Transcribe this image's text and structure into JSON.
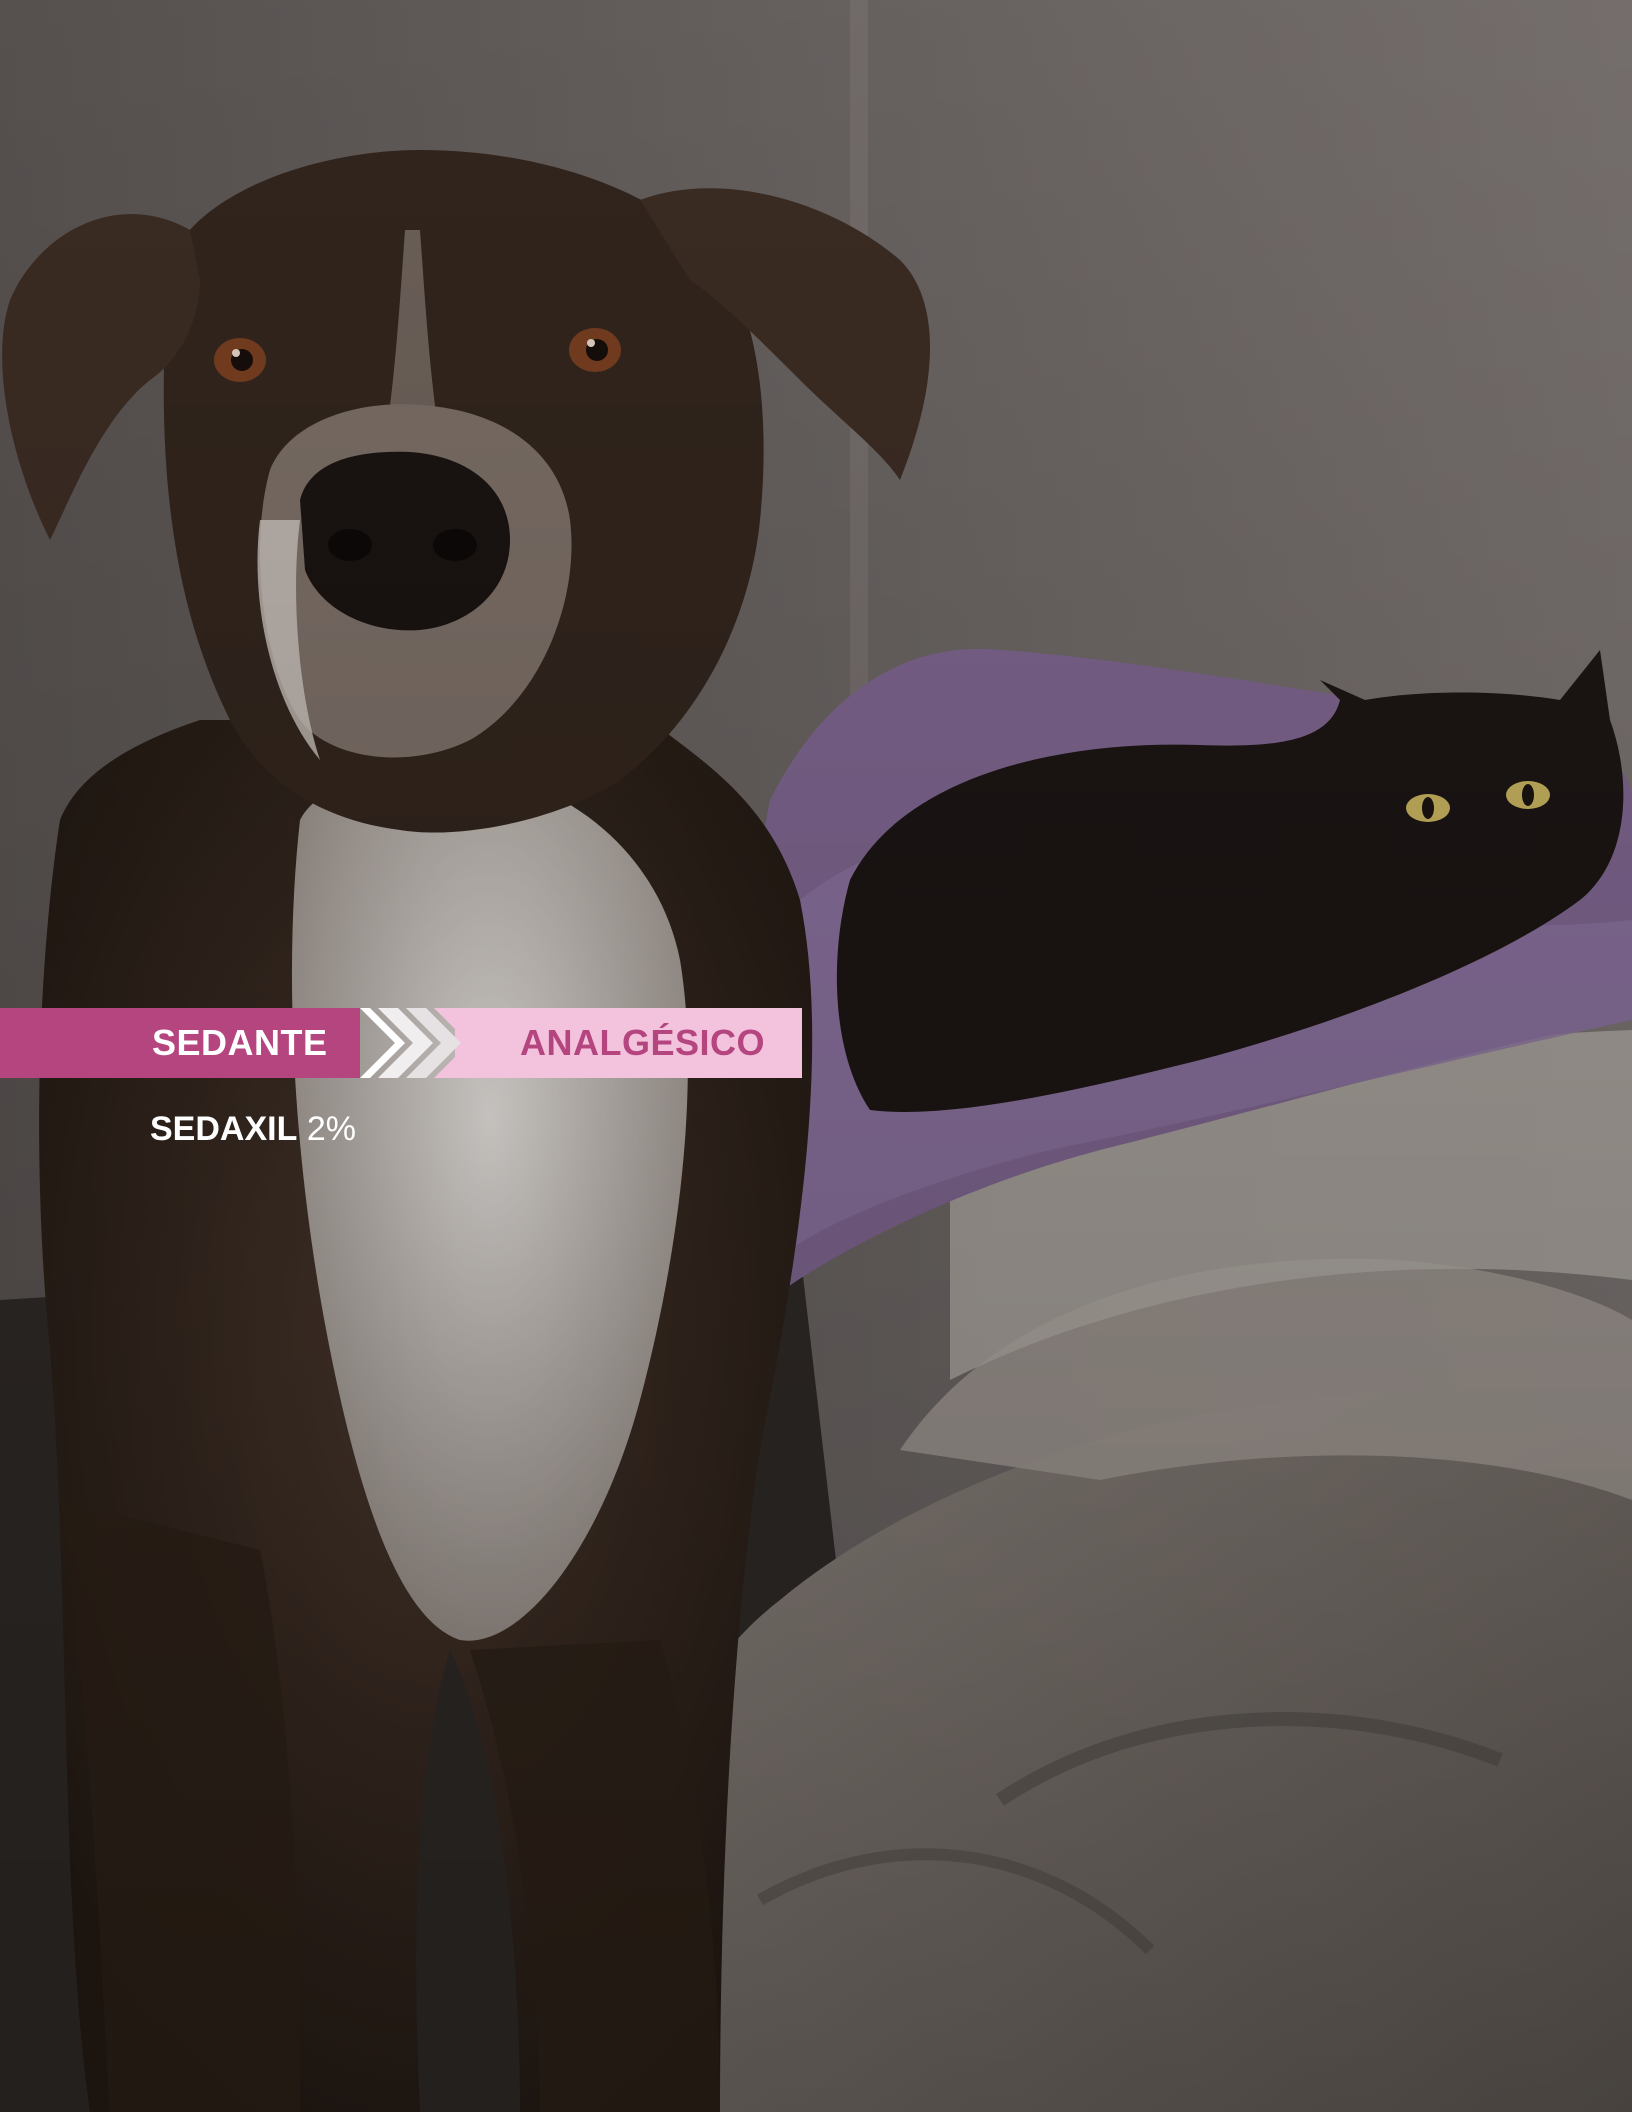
{
  "banner": {
    "left_label": "SEDANTE",
    "right_label": "ANALGÉSICO"
  },
  "product": {
    "name": "SEDAXIL",
    "concentration": "2%"
  },
  "colors": {
    "magenta": "#b5457f",
    "light_pink": "#f3c2dd",
    "text_light": "#ffffff"
  }
}
